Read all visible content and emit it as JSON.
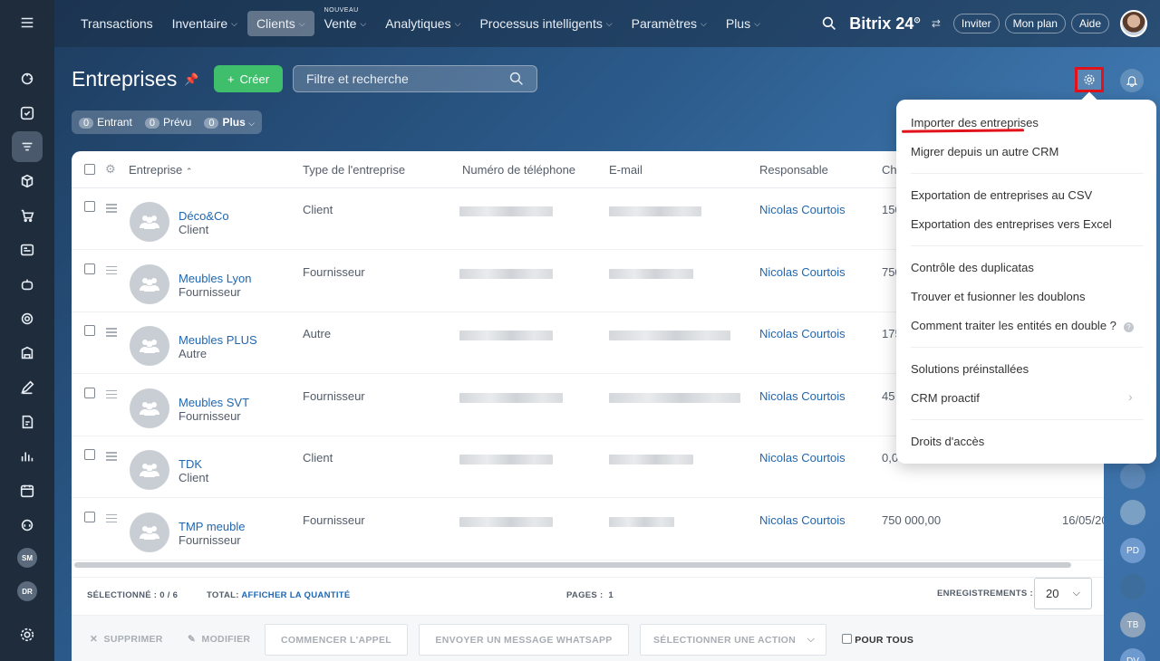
{
  "nav": {
    "items": [
      {
        "label": "Transactions",
        "chevron": false
      },
      {
        "label": "Inventaire",
        "chevron": true
      },
      {
        "label": "Clients",
        "chevron": true,
        "active": true
      },
      {
        "label": "Vente",
        "chevron": true,
        "badge": "NOUVEAU"
      },
      {
        "label": "Analytiques",
        "chevron": true
      },
      {
        "label": "Processus intelligents",
        "chevron": true
      },
      {
        "label": "Paramètres",
        "chevron": true
      },
      {
        "label": "Plus",
        "chevron": true
      }
    ],
    "brand": "Bitrix 24",
    "brand_sup": "⊙",
    "invite": "Inviter",
    "plan": "Mon plan",
    "help": "Aide"
  },
  "page": {
    "title": "Entreprises",
    "create": "Créer",
    "search_placeholder": "Filtre et recherche",
    "counters": [
      {
        "num": "0",
        "label": "Entrant"
      },
      {
        "num": "0",
        "label": "Prévu"
      },
      {
        "num": "0",
        "label": "Plus"
      }
    ]
  },
  "table": {
    "headers": {
      "company": "Entreprise",
      "type": "Type de l'entreprise",
      "phone": "Numéro de téléphone",
      "email": "E-mail",
      "responsible": "Responsable",
      "revenue": "Ch"
    },
    "rows": [
      {
        "name": "Déco&Co",
        "sub": "Client",
        "type": "Client",
        "responsible": "Nicolas Courtois",
        "revenue": "150",
        "date": ""
      },
      {
        "name": "Meubles Lyon",
        "sub": "Fournisseur",
        "type": "Fournisseur",
        "responsible": "Nicolas Courtois",
        "revenue": "750",
        "date": ""
      },
      {
        "name": "Meubles PLUS",
        "sub": "Autre",
        "type": "Autre",
        "responsible": "Nicolas Courtois",
        "revenue": "175",
        "date": ""
      },
      {
        "name": "Meubles SVT",
        "sub": "Fournisseur",
        "type": "Fournisseur",
        "responsible": "Nicolas Courtois",
        "revenue": "45",
        "date": ""
      },
      {
        "name": "TDK",
        "sub": "Client",
        "type": "Client",
        "responsible": "Nicolas Courtois",
        "revenue": "0,0",
        "date": ""
      },
      {
        "name": "TMP meuble",
        "sub": "Fournisseur",
        "type": "Fournisseur",
        "responsible": "Nicolas Courtois",
        "revenue": "750 000,00",
        "date": "16/05/20"
      }
    ]
  },
  "footer": {
    "selected_label": "SÉLECTIONNÉ :",
    "selected_value": "0 / 6",
    "total_label": "TOTAL:",
    "total_link": "AFFICHER LA QUANTITÉ",
    "pages_label": "PAGES :",
    "pages_value": "1",
    "records_label": "ENREGISTREMENTS :",
    "records_value": "20",
    "delete": "SUPPRIMER",
    "edit": "MODIFIER",
    "call": "COMMENCER L'APPEL",
    "whatsapp": "ENVOYER UN MESSAGE WHATSAPP",
    "action": "SÉLECTIONNER UNE ACTION",
    "for_all": "POUR TOUS"
  },
  "menu": {
    "items": [
      "Importer des entreprises",
      "Migrer depuis un autre CRM",
      "Exportation de entreprises au CSV",
      "Exportation des entreprises vers Excel",
      "Contrôle des duplicatas",
      "Trouver et fusionner les doublons",
      "Comment traiter les entités en double ?",
      "Solutions préinstallées",
      "CRM proactif",
      "Droits d'accès"
    ]
  },
  "sidebar": {
    "avatars": [
      "SM",
      "DR"
    ]
  },
  "right_avatars": [
    "PD",
    "TB",
    "DV"
  ],
  "colors": {
    "accent_green": "#3fbf6b",
    "link_blue": "#2067b0",
    "highlight_red": "#e2121a"
  }
}
